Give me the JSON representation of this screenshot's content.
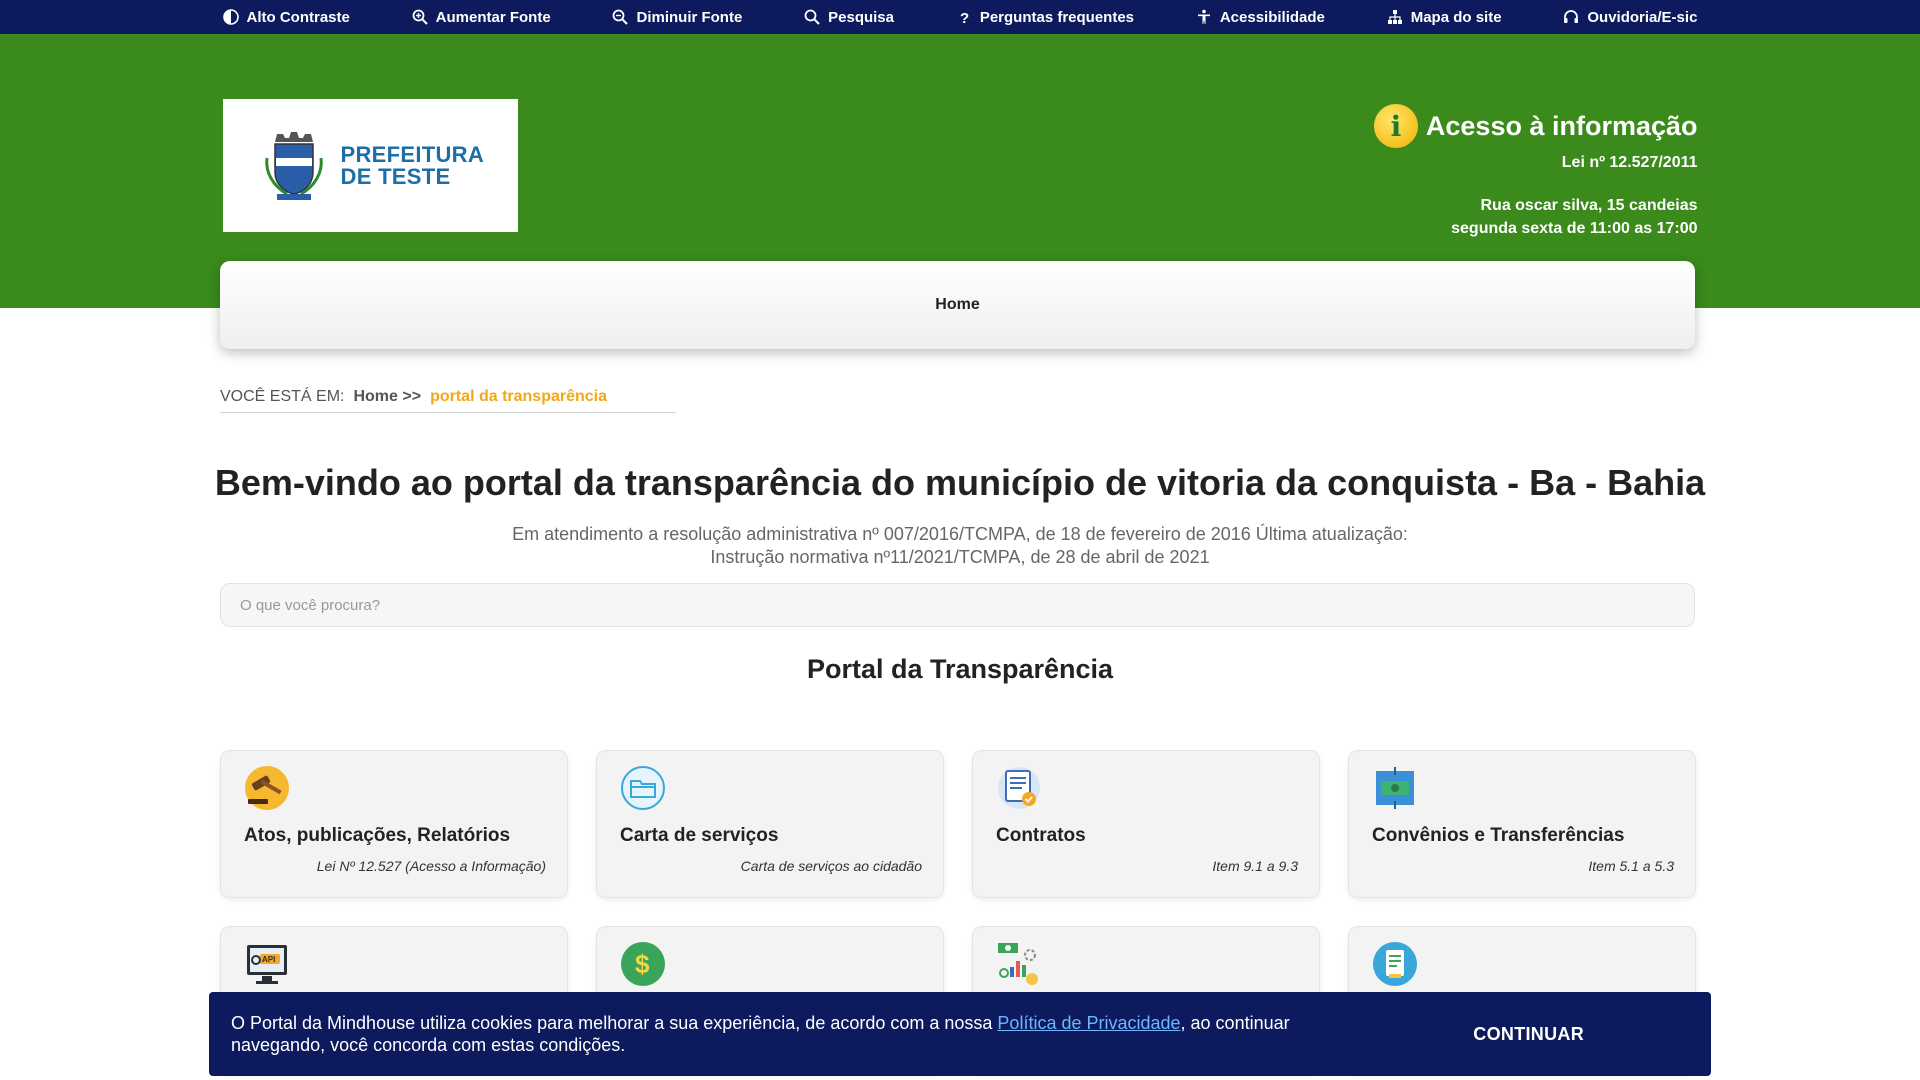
{
  "topbar": {
    "items": [
      {
        "label": "Alto Contraste",
        "icon": "contrast-icon"
      },
      {
        "label": "Aumentar Fonte",
        "icon": "zoom-in-icon"
      },
      {
        "label": "Diminuir Fonte",
        "icon": "zoom-out-icon"
      },
      {
        "label": "Pesquisa",
        "icon": "search-icon"
      },
      {
        "label": "Perguntas frequentes",
        "icon": "question-icon"
      },
      {
        "label": "Acessibilidade",
        "icon": "accessibility-icon"
      },
      {
        "label": "Mapa do site",
        "icon": "sitemap-icon"
      },
      {
        "label": "Ouvidoria/E-sic",
        "icon": "headset-icon"
      }
    ]
  },
  "header": {
    "logo_line1": "PREFEITURA",
    "logo_line2": "DE TESTE",
    "access_title": "Acesso à informação",
    "access_law": "Lei nº 12.527/2011",
    "address_line1": "Rua oscar silva, 15 candeias",
    "address_line2": "segunda sexta de 11:00 as 17:00",
    "info_icon_glyph": "i"
  },
  "nav": {
    "home": "Home"
  },
  "breadcrumb": {
    "label": "VOCÊ ESTÁ EM:",
    "home": "Home >>",
    "current": "portal da transparência"
  },
  "main": {
    "title": "Bem-vindo ao portal da transparência do município de vitoria da conquista - Ba - Bahia",
    "subtitle_line1": "Em atendimento a resolução administrativa nº 007/2016/TCMPA, de 18 de fevereiro de 2016 Última atualização:",
    "subtitle_line2": "Instrução normativa nº11/2021/TCMPA, de 28 de abril de 2021",
    "search_placeholder": "O que você procura?",
    "section_title": "Portal da Transparência"
  },
  "cards": [
    {
      "title": "Atos, publicações, Relatórios",
      "desc": "Lei Nº 12.527 (Acesso a Informação)",
      "icon": "gavel-icon"
    },
    {
      "title": "Carta de serviços",
      "desc": "Carta de serviços ao cidadão",
      "icon": "folder-icon"
    },
    {
      "title": "Contratos",
      "desc": "Item 9.1 a 9.3",
      "icon": "contract-icon"
    },
    {
      "title": "Convênios e Transferências",
      "desc": "Item 5.1 a 5.3",
      "icon": "transfer-icon"
    },
    {
      "title": "",
      "desc": "",
      "icon": "api-monitor-icon"
    },
    {
      "title": "",
      "desc": "",
      "icon": "dollar-icon"
    },
    {
      "title": "",
      "desc": "",
      "icon": "finance-chart-icon"
    },
    {
      "title": "",
      "desc": "",
      "icon": "document-icon"
    }
  ],
  "cookie": {
    "text_before": "O Portal da Mindhouse utiliza cookies para melhorar a sua experiência, de acordo com a nossa ",
    "link": "Política de Privacidade",
    "text_after": ", ao continuar navegando, você concorda com estas condições.",
    "button": "CONTINUAR"
  },
  "colors": {
    "topbar": "#0d1b5e",
    "header_green": "#3a8a1c",
    "breadcrumb_current": "#f0a818",
    "logo_text": "#1d6fa5"
  }
}
